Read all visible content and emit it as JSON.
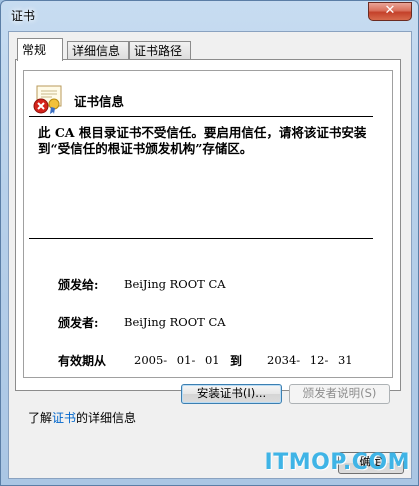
{
  "window": {
    "title": "证书",
    "close_glyph": "✕"
  },
  "tabs": [
    {
      "label": "常规"
    },
    {
      "label": "详细信息"
    },
    {
      "label": "证书路径"
    }
  ],
  "general": {
    "info_title": "证书信息",
    "warning": "此 CA 根目录证书不受信任。要启用信任，请将该证书安装到“受信任的根证书颁发机构”存储区。",
    "issued_to_label": "颁发给:",
    "issued_to_value": "BeiJing ROOT CA",
    "issued_by_label": "颁发者:",
    "issued_by_value": "BeiJing ROOT CA",
    "validity_label": "有效期从",
    "valid_from": "2005- 01- 01",
    "to_label": "到",
    "valid_to": "2034- 12- 31"
  },
  "buttons": {
    "install": "安装证书(I)...",
    "issuer_statement": "颁发者说明(S)",
    "ok": "确定"
  },
  "footer": {
    "learn_more_prefix": "了解",
    "learn_more_link": "证书",
    "learn_more_suffix": "的详细信息"
  },
  "watermark": "ITMOP.COM",
  "colors": {
    "link": "#0066cc",
    "watermark": "#3fb4e6",
    "close": "#c4412a"
  },
  "icons": {
    "certificate": "certificate-error-icon"
  }
}
